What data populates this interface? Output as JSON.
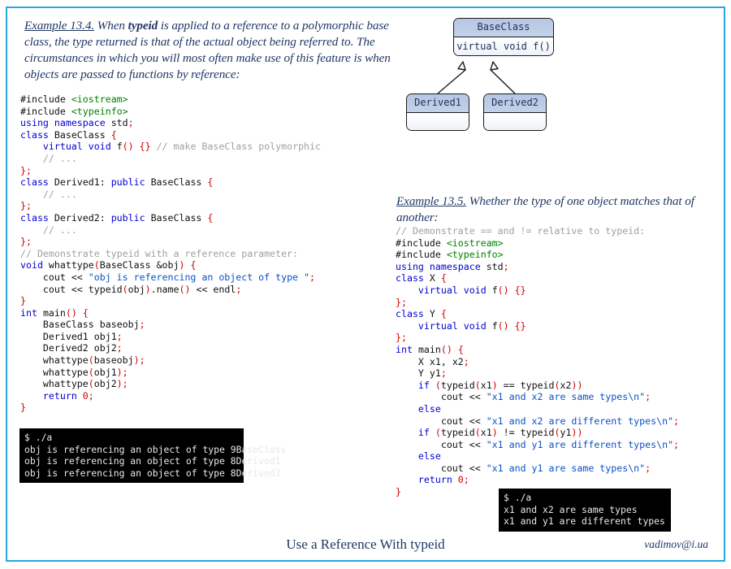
{
  "slide": {
    "border_color": "#27a7de",
    "footer_title": "Use a Reference With typeid",
    "footer_email": "vadimov@i.ua"
  },
  "example_134": {
    "label": "Example 13.4.",
    "text_part1": " When ",
    "bold1": "typeid",
    "text_part2": " is applied to a reference to a polymorphic base class, the type returned is that of the actual object being referred to. The circumstances in which you will most often make use of this feature is when objects are passed to functions by reference:"
  },
  "example_135": {
    "label": "Example 13.5.",
    "text_part1": " Whether the type of one object matches that of another:"
  },
  "uml": {
    "base": {
      "name": "BaseClass",
      "member": "virtual void f()"
    },
    "derived1": {
      "name": "Derived1",
      "member": ""
    },
    "derived2": {
      "name": "Derived2",
      "member": ""
    }
  },
  "code_left": {
    "lines": [
      "#include <iostream>",
      "#include <typeinfo>",
      "using namespace std;",
      "class BaseClass {",
      "    virtual void f() {} // make BaseClass polymorphic",
      "    // ...",
      "};",
      "class Derived1: public BaseClass {",
      "    // ...",
      "};",
      "class Derived2: public BaseClass {",
      "    // ...",
      "};",
      "// Demonstrate typeid with a reference parameter:",
      "void whattype(BaseClass &obj) {",
      "    cout << \"obj is referencing an object of type \";",
      "    cout << typeid(obj).name() << endl;",
      "}",
      "int main() {",
      "    BaseClass baseobj;",
      "    Derived1 obj1;",
      "    Derived2 obj2;",
      "    whattype(baseobj);",
      "    whattype(obj1);",
      "    whattype(obj2);",
      "    return 0;",
      "}"
    ]
  },
  "code_right": {
    "lines": [
      "// Demonstrate == and != relative to typeid:",
      "#include <iostream>",
      "#include <typeinfo>",
      "using namespace std;",
      "class X {",
      "    virtual void f() {}",
      "};",
      "class Y {",
      "    virtual void f() {}",
      "};",
      "int main() {",
      "    X x1, x2;",
      "    Y y1;",
      "    if (typeid(x1) == typeid(x2))",
      "        cout << \"x1 and x2 are same types\\n\";",
      "    else",
      "        cout << \"x1 and x2 are different types\\n\";",
      "    if (typeid(x1) != typeid(y1))",
      "        cout << \"x1 and y1 are different types\\n\";",
      "    else",
      "        cout << \"x1 and y1 are same types\\n\";",
      "    return 0;",
      "}"
    ]
  },
  "terminal_left": {
    "lines": [
      "$ ./a",
      "obj is referencing an object of type 9BaseClass",
      "obj is referencing an object of type 8Derived1",
      "obj is referencing an object of type 8Derived2"
    ]
  },
  "terminal_right": {
    "lines": [
      "$ ./a",
      "x1 and x2 are same types",
      "x1 and y1 are different types"
    ]
  }
}
